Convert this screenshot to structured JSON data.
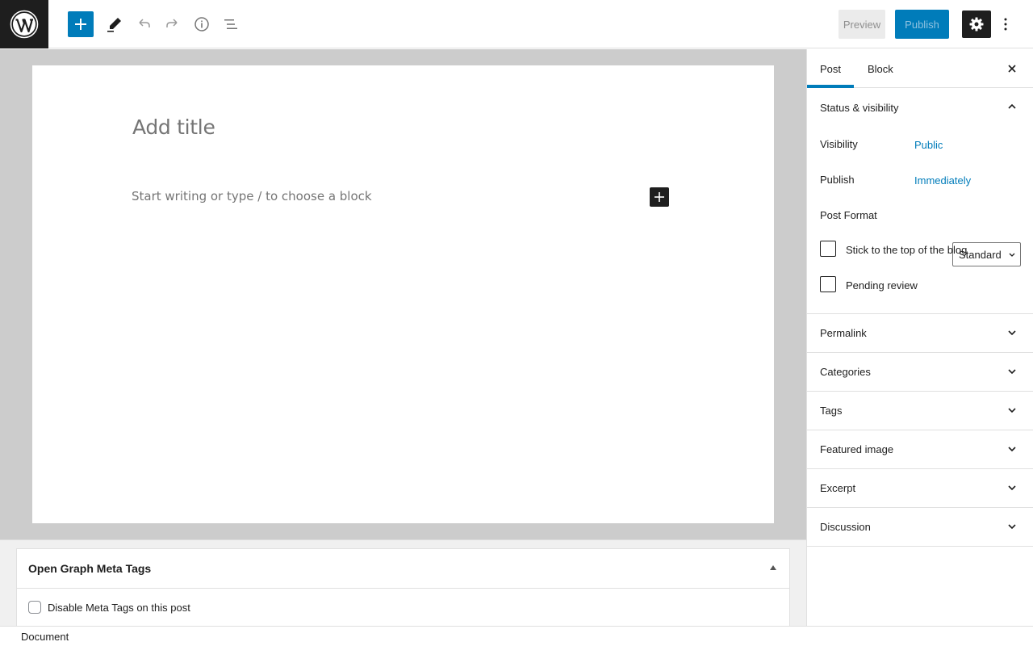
{
  "toolbar": {
    "preview_label": "Preview",
    "publish_label": "Publish"
  },
  "editor": {
    "title_placeholder": "Add title",
    "body_placeholder": "Start writing or type / to choose a block"
  },
  "metabox": {
    "title": "Open Graph Meta Tags",
    "checkbox_label": "Disable Meta Tags on this post"
  },
  "footer": {
    "breadcrumb": "Document"
  },
  "sidebar": {
    "tabs": [
      {
        "label": "Post",
        "active": true
      },
      {
        "label": "Block",
        "active": false
      }
    ],
    "status_panel": {
      "title": "Status & visibility",
      "visibility_label": "Visibility",
      "visibility_value": "Public",
      "publish_label": "Publish",
      "publish_value": "Immediately",
      "format_label": "Post Format",
      "format_value": "Standard",
      "sticky_label": "Stick to the top of the blog",
      "pending_label": "Pending review"
    },
    "panels": [
      {
        "label": "Permalink"
      },
      {
        "label": "Categories"
      },
      {
        "label": "Tags"
      },
      {
        "label": "Featured image"
      },
      {
        "label": "Excerpt"
      },
      {
        "label": "Discussion"
      }
    ]
  },
  "colors": {
    "accent": "#007cba",
    "dark": "#1e1e1e",
    "canvas_bg": "#cccccc"
  }
}
